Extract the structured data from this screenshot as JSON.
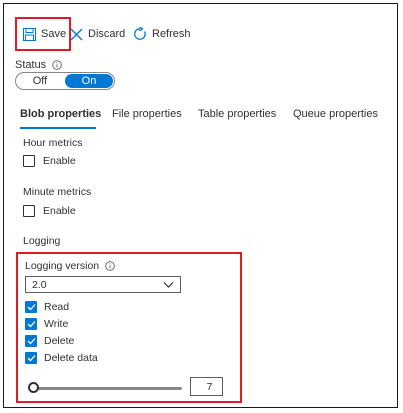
{
  "toolbar": {
    "save_label": "Save",
    "discard_label": "Discard",
    "refresh_label": "Refresh"
  },
  "status": {
    "label": "Status",
    "off_label": "Off",
    "on_label": "On",
    "selected": "On"
  },
  "tabs": [
    {
      "label": "Blob properties",
      "active": true
    },
    {
      "label": "File properties",
      "active": false
    },
    {
      "label": "Table properties",
      "active": false
    },
    {
      "label": "Queue properties",
      "active": false
    }
  ],
  "hour_metrics": {
    "label": "Hour metrics",
    "enable_label": "Enable",
    "checked": false
  },
  "minute_metrics": {
    "label": "Minute metrics",
    "enable_label": "Enable",
    "checked": false
  },
  "logging": {
    "label": "Logging",
    "version_label": "Logging version",
    "version_value": "2.0",
    "options": [
      {
        "label": "Read",
        "checked": true
      },
      {
        "label": "Write",
        "checked": true
      },
      {
        "label": "Delete",
        "checked": true
      },
      {
        "label": "Delete data",
        "checked": true
      }
    ],
    "retention_value": "7"
  },
  "colors": {
    "accent": "#0078d4",
    "highlight": "#e01b24"
  }
}
